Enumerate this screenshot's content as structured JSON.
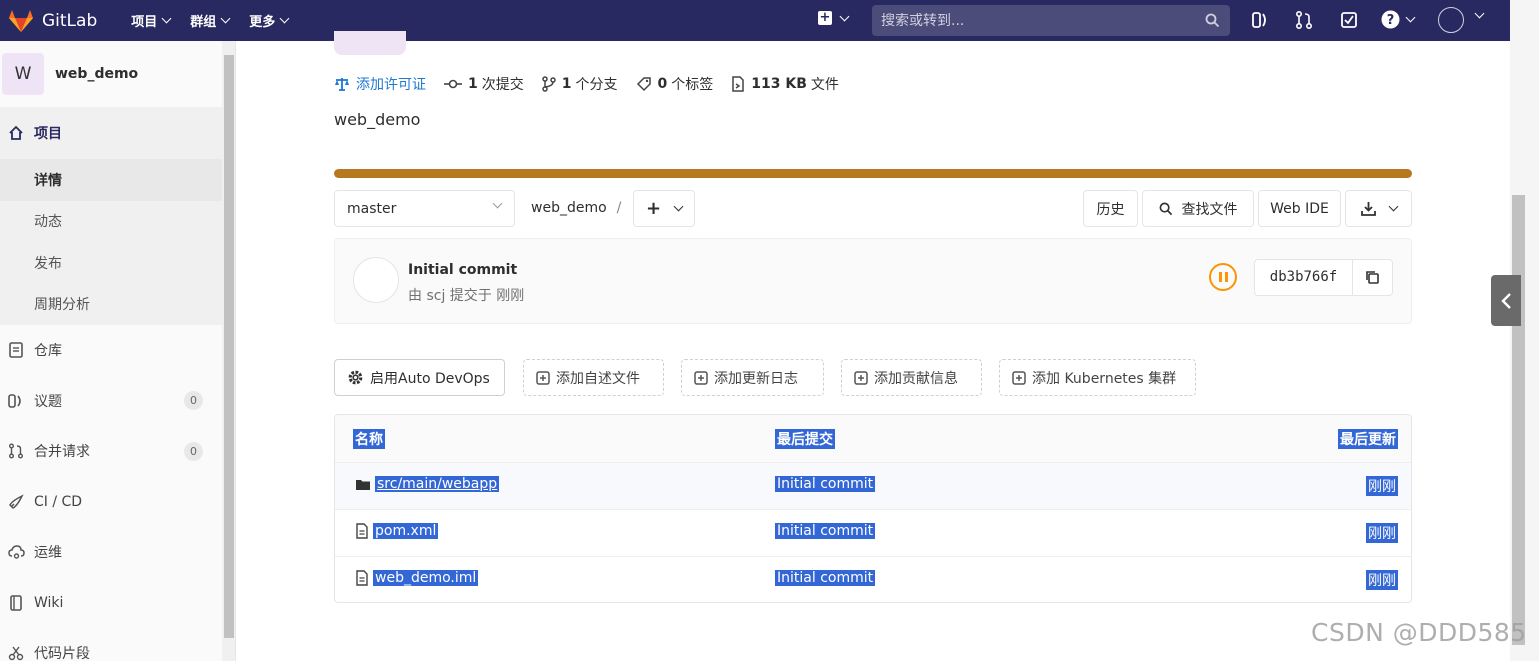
{
  "navbar": {
    "brand": "GitLab",
    "menu": [
      "项目",
      "群组",
      "更多"
    ],
    "search_placeholder": "搜索或转到..."
  },
  "sidebar": {
    "project_avatar_letter": "W",
    "project_name": "web_demo",
    "section_title": "项目",
    "sub_items": [
      "详情",
      "动态",
      "发布",
      "周期分析"
    ],
    "active_sub": "详情",
    "items": [
      {
        "label": "仓库"
      },
      {
        "label": "议题",
        "count": "0"
      },
      {
        "label": "合并请求",
        "count": "0"
      },
      {
        "label": "CI / CD"
      },
      {
        "label": "运维"
      },
      {
        "label": "Wiki"
      },
      {
        "label": "代码片段"
      }
    ]
  },
  "stats": {
    "license_link": "添加许可证",
    "commits_count": "1",
    "commits_label": "次提交",
    "branches_count": "1",
    "branches_label": "个分支",
    "tags_count": "0",
    "tags_label": "个标签",
    "size": "113 KB",
    "size_label": "文件"
  },
  "description": "web_demo",
  "branch": "master",
  "breadcrumb": {
    "project": "web_demo",
    "sep": "/"
  },
  "toolbar": {
    "history": "历史",
    "find_file": "查找文件",
    "web_ide": "Web IDE"
  },
  "commit": {
    "title": "Initial commit",
    "meta": "由 scj 提交于 刚刚",
    "sha": "db3b766f"
  },
  "quick_actions": [
    "启用Auto DevOps",
    "添加自述文件",
    "添加更新日志",
    "添加贡献信息",
    "添加 Kubernetes 集群"
  ],
  "file_table": {
    "headers": [
      "名称",
      "最后提交",
      "最后更新"
    ],
    "rows": [
      {
        "type": "folder",
        "name": "src/main/webapp",
        "commit": "Initial commit",
        "updated": "刚刚"
      },
      {
        "type": "file",
        "name": "pom.xml",
        "commit": "Initial commit",
        "updated": "刚刚"
      },
      {
        "type": "file",
        "name": "web_demo.iml",
        "commit": "Initial commit",
        "updated": "刚刚"
      }
    ]
  },
  "watermark": "CSDN @DDD585",
  "colors": {
    "navbar": "#292961",
    "progress": "#b7791f",
    "selection": "#3367d6",
    "link": "#1f78d1",
    "pipeline": "#fc9403"
  }
}
